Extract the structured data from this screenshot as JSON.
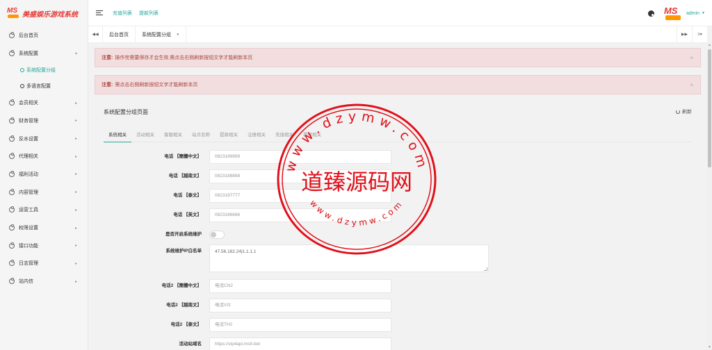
{
  "app": {
    "title": "美盛娱乐游戏系统",
    "logo_text": "MS",
    "logo_sub": "GAME"
  },
  "header": {
    "links": [
      "充值列表",
      "提款列表"
    ],
    "user": "admin"
  },
  "sidebar": {
    "items": [
      {
        "label": "后台首页",
        "has_arrow": false
      },
      {
        "label": "系统配置",
        "has_arrow": true,
        "expanded": true,
        "children": [
          {
            "label": "系统配置分组",
            "active": true
          },
          {
            "label": "多语言配置",
            "active": false
          }
        ]
      },
      {
        "label": "会员相关",
        "has_arrow": true
      },
      {
        "label": "财务管理",
        "has_arrow": true
      },
      {
        "label": "反水设置",
        "has_arrow": true
      },
      {
        "label": "代理相关",
        "has_arrow": true
      },
      {
        "label": "福利活动",
        "has_arrow": true
      },
      {
        "label": "内容管理",
        "has_arrow": true
      },
      {
        "label": "运营工具",
        "has_arrow": true
      },
      {
        "label": "权限设置",
        "has_arrow": true
      },
      {
        "label": "接口功能",
        "has_arrow": true
      },
      {
        "label": "日志管理",
        "has_arrow": true
      },
      {
        "label": "站内信",
        "has_arrow": true
      }
    ]
  },
  "tabbar": {
    "tabs": [
      {
        "label": "后台首页",
        "active": false
      },
      {
        "label": "系统配置分组",
        "active": true
      }
    ]
  },
  "notices": [
    {
      "prefix": "注意:",
      "text": "操作完需要保存才会生效,需点击右侧刷新按钮文字才能刷新本页"
    },
    {
      "prefix": "注意:",
      "text": "需点击右侧刷新按钮文字才能刷新本页"
    }
  ],
  "panel": {
    "title": "系统配置分组页面",
    "refresh_label": "刷新",
    "subtabs": [
      "系统相关",
      "活动相关",
      "客服相关",
      "站点名称",
      "提款相关",
      "注册相关",
      "充值相关",
      "提醒相关"
    ],
    "active_subtab": 0,
    "fields": [
      {
        "label": "电话 【簡體中文】",
        "type": "input",
        "value": "0823189999"
      },
      {
        "label": "电话 【越南文】",
        "type": "input",
        "value": "0823188888"
      },
      {
        "label": "电话 【泰文】",
        "type": "input",
        "value": "0823187777"
      },
      {
        "label": "电话 【英文】",
        "type": "input",
        "value": "0823186666"
      },
      {
        "label": "是否开启系统维护",
        "type": "toggle",
        "value": "off"
      },
      {
        "label": "系统维护IP白名单",
        "type": "textarea",
        "value": "47.56.182.24|1.1.1.1"
      },
      {
        "label": "电话2 【簡體中文】",
        "type": "input",
        "value": "电话CN2"
      },
      {
        "label": "电话2 【越南文】",
        "type": "input",
        "value": "电话VI2"
      },
      {
        "label": "电话2 【泰文】",
        "type": "input",
        "value": "电话TH2"
      },
      {
        "label": "活动站域名",
        "type": "input",
        "value": "https://vip4api.msh.bet"
      }
    ]
  },
  "watermark": {
    "center_text": "道臻源码网",
    "ring_top": "www.dzymw.com",
    "ring_bottom": "www.dzymw.com"
  },
  "colors": {
    "accent": "#26a69a",
    "notice_bg": "#f2dede",
    "notice_text": "#a94442",
    "watermark": "#e0101a",
    "logo": "#e53935"
  }
}
